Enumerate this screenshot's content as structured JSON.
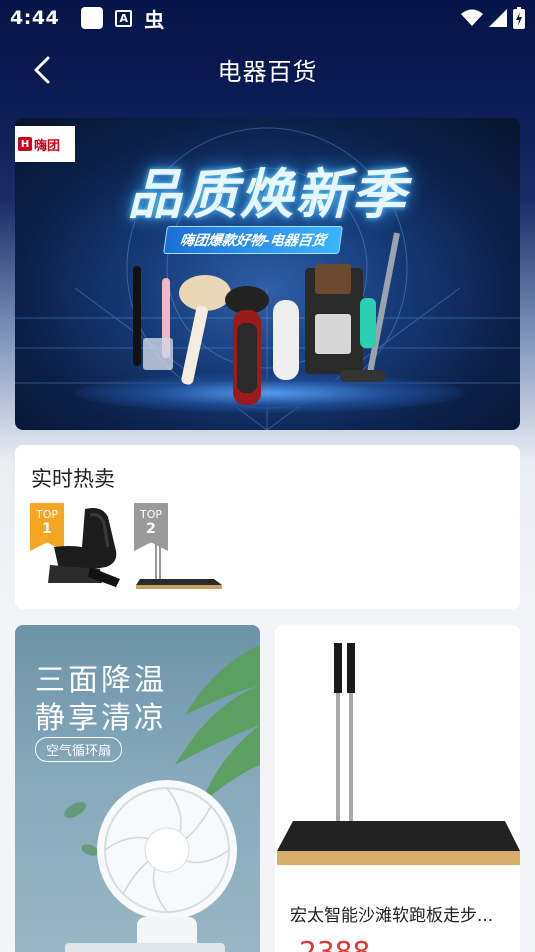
{
  "status_bar": {
    "time": "4:44",
    "icons_left": [
      "square-icon",
      "a-icon",
      "bug-icon"
    ],
    "icons_right": [
      "wifi-icon",
      "signal-icon",
      "battery-charging-icon"
    ]
  },
  "header": {
    "title": "电器百货",
    "back_icon": "chevron-left-icon"
  },
  "banner": {
    "brand": "嗨团",
    "headline": "品质焕新季",
    "subtitle": "嗨团爆款好物-电器百货"
  },
  "hot_sale": {
    "title": "实时热卖",
    "items": [
      {
        "badge": "TOP",
        "rank": "1",
        "badge_color": "#f5a623",
        "product": "massage-chair"
      },
      {
        "badge": "TOP",
        "rank": "2",
        "badge_color": "#9a9a9a",
        "product": "treadmill"
      }
    ]
  },
  "products": {
    "promo": {
      "line1": "三面降温",
      "line2": "静享清凉",
      "tag": "空气循环扇"
    },
    "item": {
      "title": "宏太智能沙滩软跑板走步...",
      "price": "2388"
    }
  },
  "colors": {
    "header_bg": "#061449",
    "page_bg": "#f3f4f7",
    "price": "#e8332f",
    "top1": "#f5a623",
    "top2": "#9a9a9a"
  }
}
